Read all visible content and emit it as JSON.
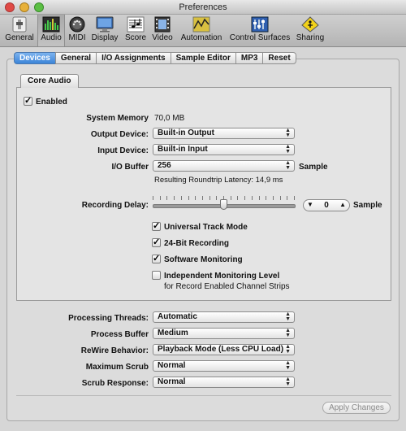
{
  "window": {
    "title": "Preferences"
  },
  "toolbar": {
    "items": [
      {
        "label": "General",
        "icon": "general-switch-icon"
      },
      {
        "label": "Audio",
        "icon": "audio-meter-icon",
        "active": true
      },
      {
        "label": "MIDI",
        "icon": "midi-connector-icon"
      },
      {
        "label": "Display",
        "icon": "display-monitor-icon"
      },
      {
        "label": "Score",
        "icon": "score-notes-icon"
      },
      {
        "label": "Video",
        "icon": "video-film-icon"
      },
      {
        "label": "Automation",
        "icon": "automation-curve-icon"
      },
      {
        "label": "Control Surfaces",
        "icon": "control-surfaces-icon"
      },
      {
        "label": "Sharing",
        "icon": "sharing-warning-icon"
      }
    ]
  },
  "tabs": [
    {
      "label": "Devices",
      "active": true
    },
    {
      "label": "General"
    },
    {
      "label": "I/O Assignments"
    },
    {
      "label": "Sample Editor"
    },
    {
      "label": "MP3"
    },
    {
      "label": "Reset"
    }
  ],
  "core_audio": {
    "tab_label": "Core Audio",
    "enabled_label": "Enabled",
    "enabled": true,
    "system_memory_label": "System Memory",
    "system_memory_value": "70,0 MB",
    "output_device_label": "Output Device:",
    "output_device_value": "Built-in Output",
    "input_device_label": "Input Device:",
    "input_device_value": "Built-in Input",
    "io_buffer_label": "I/O Buffer",
    "io_buffer_value": "256",
    "io_buffer_unit": "Sample",
    "latency_text": "Resulting Roundtrip Latency: 14,9 ms",
    "recording_delay_label": "Recording Delay:",
    "recording_delay_value": "0",
    "recording_delay_unit": "Sample",
    "recording_delay_slider_fraction": 0.5,
    "universal_track_mode_label": "Universal Track Mode",
    "bit24_label": "24-Bit Recording",
    "software_monitoring_label": "Software Monitoring",
    "independent_monitoring_label": "Independent Monitoring Level",
    "independent_monitoring_sub": "for Record Enabled Channel Strips"
  },
  "lower": {
    "processing_threads_label": "Processing Threads:",
    "processing_threads_value": "Automatic",
    "process_buffer_label": "Process Buffer",
    "process_buffer_value": "Medium",
    "rewire_label": "ReWire Behavior:",
    "rewire_value": "Playback Mode (Less CPU Load)",
    "max_scrub_label": "Maximum Scrub",
    "max_scrub_value": "Normal",
    "scrub_response_label": "Scrub Response:",
    "scrub_response_value": "Normal",
    "apply_label": "Apply Changes"
  },
  "colors": {
    "accent": "#3c84d8"
  }
}
